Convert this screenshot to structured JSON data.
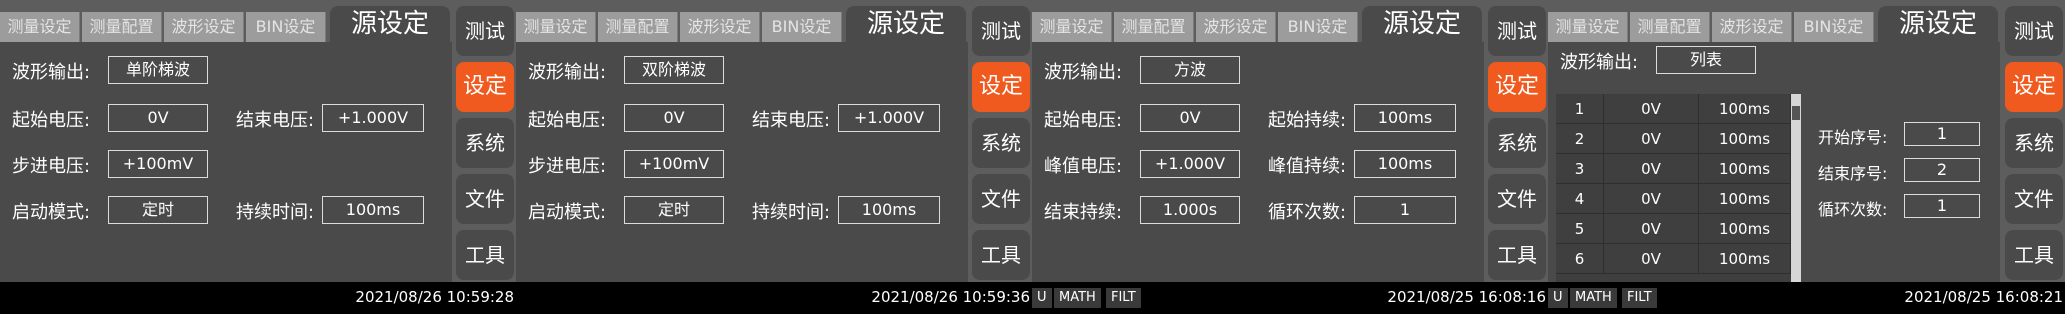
{
  "tabs": [
    "测量设定",
    "测量配置",
    "波形设定",
    "BIN设定"
  ],
  "active_tab": "源设定",
  "side_menu": [
    "测试",
    "设定",
    "系统",
    "文件",
    "工具"
  ],
  "status_badges": [
    "U",
    "MATH",
    "FILT"
  ],
  "colors": {
    "accent": "#f05a1e",
    "panel": "#5d5d5d",
    "content": "#4a4a4a",
    "status_bar": "#000000"
  },
  "panels": [
    {
      "timestamp": "2021/08/26 10:59:28",
      "waveform_label": "波形输出:",
      "waveform_value": "单阶梯波",
      "start_voltage_label": "起始电压:",
      "start_voltage_value": "0V",
      "end_voltage_label": "结束电压:",
      "end_voltage_value": "+1.000V",
      "step_voltage_label": "步进电压:",
      "step_voltage_value": "+100mV",
      "trigger_mode_label": "启动模式:",
      "trigger_mode_value": "定时",
      "duration_label": "持续时间:",
      "duration_value": "100ms"
    },
    {
      "timestamp": "2021/08/26 10:59:36",
      "waveform_label": "波形输出:",
      "waveform_value": "双阶梯波",
      "start_voltage_label": "起始电压:",
      "start_voltage_value": "0V",
      "end_voltage_label": "结束电压:",
      "end_voltage_value": "+1.000V",
      "step_voltage_label": "步进电压:",
      "step_voltage_value": "+100mV",
      "trigger_mode_label": "启动模式:",
      "trigger_mode_value": "定时",
      "duration_label": "持续时间:",
      "duration_value": "100ms"
    },
    {
      "timestamp": "2021/08/25 16:08:16",
      "waveform_label": "波形输出:",
      "waveform_value": "方波",
      "start_voltage_label": "起始电压:",
      "start_voltage_value": "0V",
      "start_duration_label": "起始持续:",
      "start_duration_value": "100ms",
      "peak_voltage_label": "峰值电压:",
      "peak_voltage_value": "+1.000V",
      "peak_duration_label": "峰值持续:",
      "peak_duration_value": "100ms",
      "end_duration_label": "结束持续:",
      "end_duration_value": "1.000s",
      "cycles_label": "循环次数:",
      "cycles_value": "1"
    },
    {
      "timestamp": "2021/08/25 16:08:21",
      "waveform_label": "波形输出:",
      "waveform_value": "列表",
      "list_rows": [
        [
          "1",
          "0V",
          "100ms"
        ],
        [
          "2",
          "0V",
          "100ms"
        ],
        [
          "3",
          "0V",
          "100ms"
        ],
        [
          "4",
          "0V",
          "100ms"
        ],
        [
          "5",
          "0V",
          "100ms"
        ],
        [
          "6",
          "0V",
          "100ms"
        ]
      ],
      "start_index_label": "开始序号:",
      "start_index_value": "1",
      "end_index_label": "结束序号:",
      "end_index_value": "2",
      "cycles_label": "循环次数:",
      "cycles_value": "1"
    }
  ]
}
